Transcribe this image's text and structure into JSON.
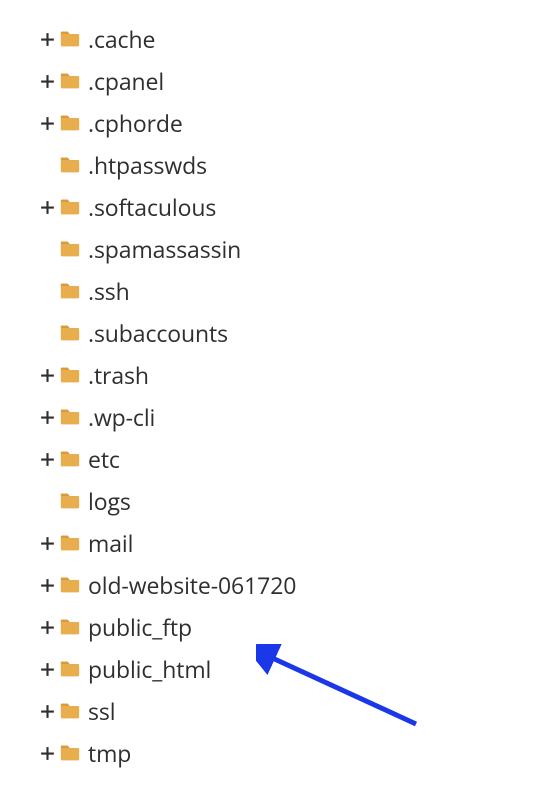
{
  "folder_color": "#e8ad4c",
  "expander_color": "#2f2f2f",
  "arrow_color": "#1a38e8",
  "tree": {
    "items": [
      {
        "name": ".cache",
        "expandable": true
      },
      {
        "name": ".cpanel",
        "expandable": true
      },
      {
        "name": ".cphorde",
        "expandable": true
      },
      {
        "name": ".htpasswds",
        "expandable": false
      },
      {
        "name": ".softaculous",
        "expandable": true
      },
      {
        "name": ".spamassassin",
        "expandable": false
      },
      {
        "name": ".ssh",
        "expandable": false
      },
      {
        "name": ".subaccounts",
        "expandable": false
      },
      {
        "name": ".trash",
        "expandable": true
      },
      {
        "name": ".wp-cli",
        "expandable": true
      },
      {
        "name": "etc",
        "expandable": true
      },
      {
        "name": "logs",
        "expandable": false
      },
      {
        "name": "mail",
        "expandable": true
      },
      {
        "name": "old-website-061720",
        "expandable": true
      },
      {
        "name": "public_ftp",
        "expandable": true
      },
      {
        "name": "public_html",
        "expandable": true,
        "highlighted": true
      },
      {
        "name": "ssl",
        "expandable": true
      },
      {
        "name": "tmp",
        "expandable": true
      }
    ]
  }
}
